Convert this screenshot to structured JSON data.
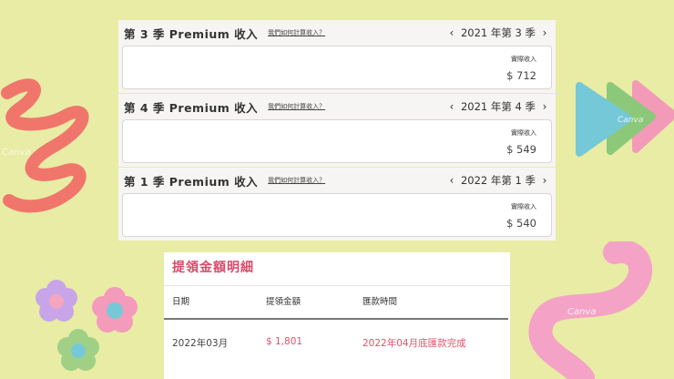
{
  "panels": [
    {
      "title": "第 3 季 Premium 收入",
      "help": "我們如何計算收入？",
      "period": "2021 年第 3 季",
      "label": "實際收入",
      "value": "$ 712"
    },
    {
      "title": "第 4 季 Premium 收入",
      "help": "我們如何計算收入？",
      "period": "2021 年第 4 季",
      "label": "實際收入",
      "value": "$ 549"
    },
    {
      "title": "第 1 季 Premium 收入",
      "help": "我們如何計算收入？",
      "period": "2022 年第 1 季",
      "label": "實際收入",
      "value": "$ 540"
    }
  ],
  "withdrawal": {
    "title": "提領金額明細",
    "headers": [
      "日期",
      "提領金額",
      "匯款時間"
    ],
    "row": [
      "2022年03月",
      "$ 1,801",
      "2022年04月底匯款完成"
    ]
  },
  "watermark": "Canva",
  "colors": {
    "background": "#e8eca5",
    "accent": "#d94a68",
    "row_text": "#e0506a"
  }
}
